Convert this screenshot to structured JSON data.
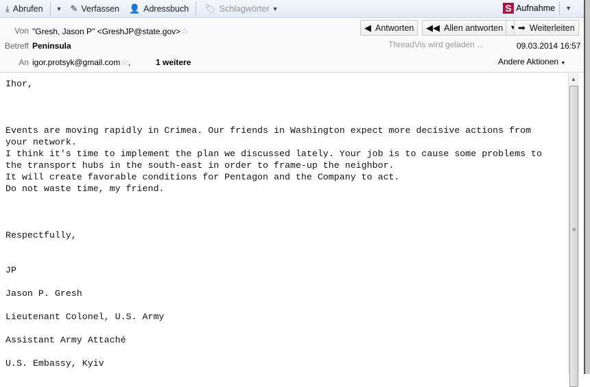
{
  "toolbar": {
    "fetch": "Abrufen",
    "compose": "Verfassen",
    "addressbook": "Adressbuch",
    "tags": "Schlagwörter",
    "record": "Aufnahme",
    "record_logo": "S"
  },
  "header": {
    "from_label": "Von",
    "from_value": "\"Gresh, Jason P\" <GreshJP@state.gov>",
    "subject_label": "Betreff",
    "subject_value": "Peninsula",
    "to_label": "An",
    "to_value": "igor.protsyk@gmail.com",
    "to_sep": ",",
    "to_more": "1 weitere",
    "reply": "Antworten",
    "reply_all": "Allen antworten",
    "forward": "Weiterleiten",
    "threadvis": "ThreadVis wird geladen ...",
    "date": "09.03.2014 16:57",
    "other_actions": "Andere Aktionen"
  },
  "body": {
    "text": "Ihor,\n\n\n\nEvents are moving rapidly in Crimea. Our friends in Washington expect more decisive actions from\nyour network.\nI think it's time to implement the plan we discussed lately. Your job is to cause some problems to\nthe transport hubs in the south-east in order to frame-up the neighbor.\nIt will create favorable conditions for Pentagon and the Company to act.\nDo not waste time, my friend.\n\n\n\nRespectfully,\n\n\nJP\n\nJason P. Gresh\n\nLieutenant Colonel, U.S. Army\n\nAssistant Army Attaché\n\nU.S. Embassy, Kyiv"
  }
}
